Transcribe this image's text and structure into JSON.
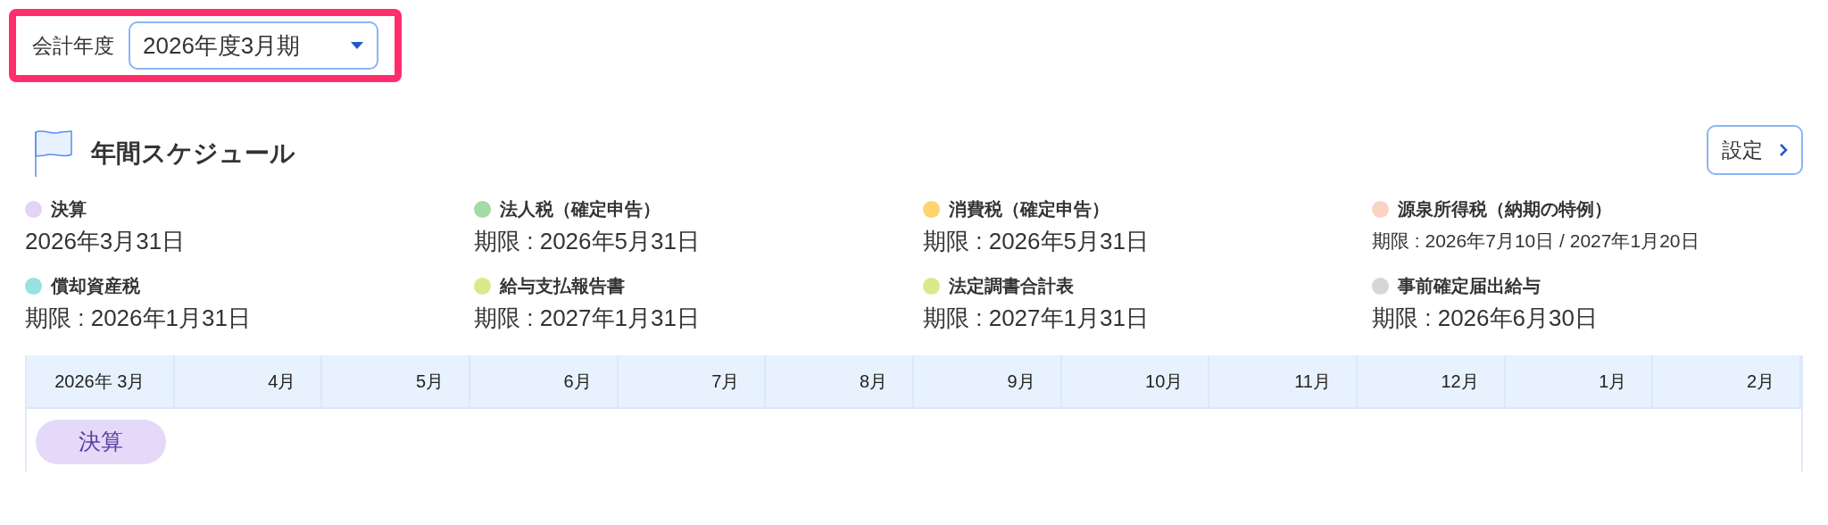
{
  "fiscal_year": {
    "label": "会計年度",
    "value": "2026年度3月期"
  },
  "schedule": {
    "title": "年間スケジュール",
    "settings_button": "設定",
    "items": [
      {
        "name": "決算",
        "date": "2026年3月31日",
        "color": "#e3d3fa",
        "compact": false
      },
      {
        "name": "法人税（確定申告）",
        "date": "期限 : 2026年5月31日",
        "color": "#a3dba5",
        "compact": false
      },
      {
        "name": "消費税（確定申告）",
        "date": "期限 : 2026年5月31日",
        "color": "#ffd36e",
        "compact": false
      },
      {
        "name": "源泉所得税（納期の特例）",
        "date": "期限 : 2026年7月10日 / 2027年1月20日",
        "color": "#fad3c4",
        "compact": true
      },
      {
        "name": "償却資産税",
        "date": "期限 : 2026年1月31日",
        "color": "#96e2e0",
        "compact": false
      },
      {
        "name": "給与支払報告書",
        "date": "期限 : 2027年1月31日",
        "color": "#d9ea8a",
        "compact": false
      },
      {
        "name": "法定調書合計表",
        "date": "期限 : 2027年1月31日",
        "color": "#d9ea8a",
        "compact": false
      },
      {
        "name": "事前確定届出給与",
        "date": "期限 : 2026年6月30日",
        "color": "#d6d6d6",
        "compact": false
      }
    ],
    "timeline": {
      "months": [
        {
          "label": "2026年 3月",
          "events": [
            {
              "label": "決算",
              "color": "#e5d9fa"
            }
          ]
        },
        {
          "label": "4月"
        },
        {
          "label": "5月"
        },
        {
          "label": "6月"
        },
        {
          "label": "7月"
        },
        {
          "label": "8月"
        },
        {
          "label": "9月"
        },
        {
          "label": "10月"
        },
        {
          "label": "11月"
        },
        {
          "label": "12月"
        },
        {
          "label": "1月"
        },
        {
          "label": "2月"
        }
      ]
    }
  }
}
